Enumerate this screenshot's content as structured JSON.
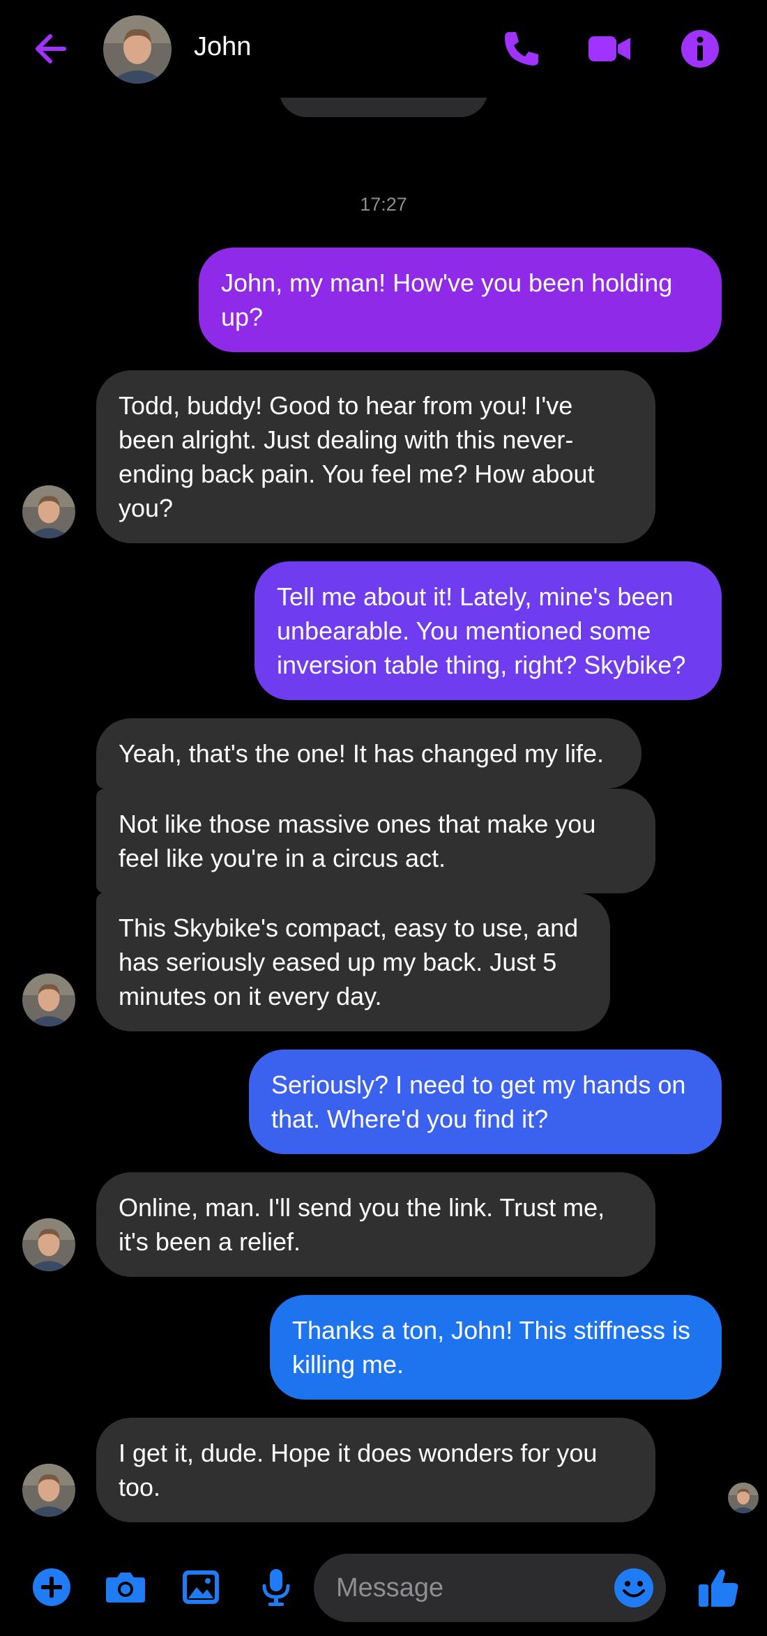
{
  "header": {
    "contact_name": "John",
    "icons": [
      "back-arrow-icon",
      "phone-icon",
      "video-camera-icon",
      "info-icon"
    ]
  },
  "colors": {
    "accent_purple": "#a033ff",
    "out_bubble_1": "#8f2ae8",
    "out_bubble_2": "#6f3cf0",
    "out_bubble_3": "#3a62ee",
    "out_bubble_4": "#1e74ee",
    "in_bubble": "#303030",
    "composer_blue": "#1f7cf5"
  },
  "conversation": {
    "timestamp": "17:27",
    "messages": [
      {
        "from": "me",
        "text": "John, my man! How've you been holding up?"
      },
      {
        "from": "John",
        "text": "Todd, buddy! Good to hear from you! I've been alright. Just dealing with this never-ending back pain. You feel me? How about you?"
      },
      {
        "from": "me",
        "text": "Tell me about it! Lately, mine's been unbearable. You mentioned some inversion table thing, right? Skybike?"
      },
      {
        "from": "John",
        "text": "Yeah, that's the one! It has changed my life."
      },
      {
        "from": "John",
        "text": "Not like those massive ones that make you feel like you're in a circus act."
      },
      {
        "from": "John",
        "text": "This Skybike's compact, easy to use, and has seriously eased up my back. Just 5 minutes on it every day."
      },
      {
        "from": "me",
        "text": "Seriously? I need to get my hands on that. Where'd you find it?"
      },
      {
        "from": "John",
        "text": "Online, man. I'll send you the link. Trust me, it's been a relief."
      },
      {
        "from": "me",
        "text": "Thanks a ton, John! This stiffness is killing me."
      },
      {
        "from": "John",
        "text": "I get it, dude. Hope it does wonders for you too."
      }
    ]
  },
  "composer": {
    "placeholder": "Message",
    "icons": [
      "plus-icon",
      "camera-icon",
      "gallery-icon",
      "microphone-icon",
      "emoji-icon",
      "thumbs-up-icon"
    ]
  }
}
